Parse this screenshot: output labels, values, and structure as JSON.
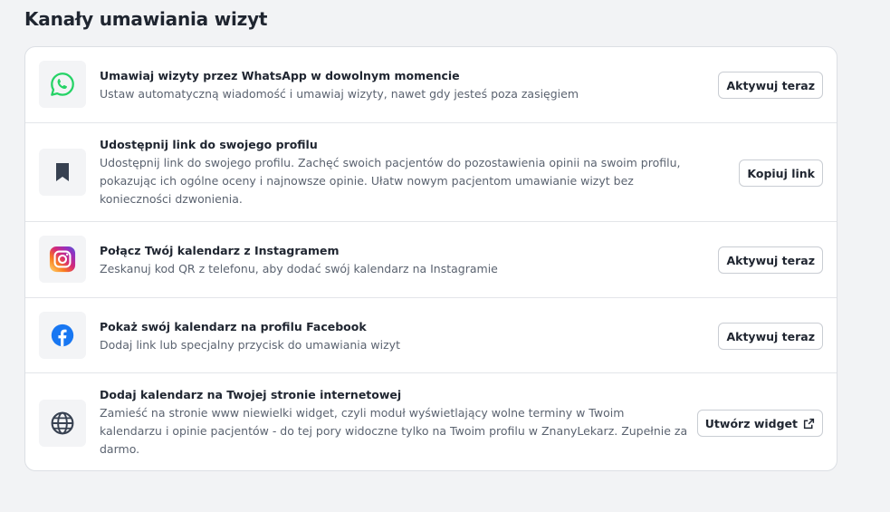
{
  "page": {
    "title": "Kanały umawiania wizyt"
  },
  "channels": [
    {
      "icon": "whatsapp-icon",
      "title": "Umawiaj wizyty przez WhatsApp w dowolnym momencie",
      "description": "Ustaw automatyczną wiadomość i umawiaj wizyty, nawet gdy jesteś poza zasięgiem",
      "button": "Aktywuj teraz"
    },
    {
      "icon": "bookmark-icon",
      "title": "Udostępnij link do swojego profilu",
      "description": "Udostępnij link do swojego profilu. Zachęć swoich pacjentów do pozostawienia opinii na swoim profilu, pokazując ich ogólne oceny i najnowsze opinie. Ułatw nowym pacjentom umawianie wizyt bez konieczności dzwonienia.",
      "button": "Kopiuj link"
    },
    {
      "icon": "instagram-icon",
      "title": "Połącz Twój kalendarz z Instagramem",
      "description": "Zeskanuj kod QR z telefonu, aby dodać swój kalendarz na Instagramie",
      "button": "Aktywuj teraz"
    },
    {
      "icon": "facebook-icon",
      "title": "Pokaż swój kalendarz na profilu Facebook",
      "description": "Dodaj link lub specjalny przycisk do umawiania wizyt",
      "button": "Aktywuj teraz"
    },
    {
      "icon": "globe-icon",
      "title": "Dodaj kalendarz na Twojej stronie internetowej",
      "description": "Zamieść na stronie www niewielki widget, czyli moduł wyświetlający wolne terminy w Twoim kalendarzu i opinie pacjentów - do tej pory widoczne tylko na Twoim profilu w ZnanyLekarz. Zupełnie za darmo.",
      "button": "Utwórz widget",
      "button_icon": "external-link-icon"
    }
  ],
  "colors": {
    "whatsapp": "#25d366",
    "bookmark": "#374151",
    "facebook": "#1877f2",
    "globe": "#374151"
  }
}
